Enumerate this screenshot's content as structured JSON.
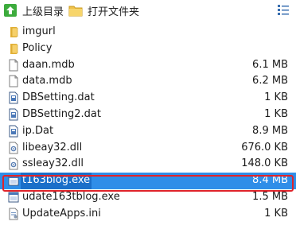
{
  "toolbar": {
    "up_label": "上级目录",
    "open_folder_label": "打开文件夹"
  },
  "files": [
    {
      "name": "imgurl",
      "size": "",
      "icon": "folder-icon"
    },
    {
      "name": "Policy",
      "size": "",
      "icon": "folder-icon"
    },
    {
      "name": "daan.mdb",
      "size": "6.1 MB",
      "icon": "file-icon"
    },
    {
      "name": "data.mdb",
      "size": "6.2 MB",
      "icon": "file-icon"
    },
    {
      "name": "DBSetting.dat",
      "size": "1 KB",
      "icon": "data-file-icon"
    },
    {
      "name": "DBSetting2.dat",
      "size": "1 KB",
      "icon": "data-file-icon"
    },
    {
      "name": "ip.Dat",
      "size": "8.9 MB",
      "icon": "data-file-icon"
    },
    {
      "name": "libeay32.dll",
      "size": "676.0 KB",
      "icon": "dll-icon"
    },
    {
      "name": "ssleay32.dll",
      "size": "148.0 KB",
      "icon": "dll-icon"
    },
    {
      "name": "t163blog.exe",
      "size": "8.4 MB",
      "icon": "exe-icon",
      "selected": true
    },
    {
      "name": "udate163tblog.exe",
      "size": "1.5 MB",
      "icon": "exe-icon"
    },
    {
      "name": "UpdateApps.ini",
      "size": "1 KB",
      "icon": "ini-icon"
    }
  ],
  "colors": {
    "selection": "#2f8ee8",
    "highlight_border": "#e0242b"
  }
}
